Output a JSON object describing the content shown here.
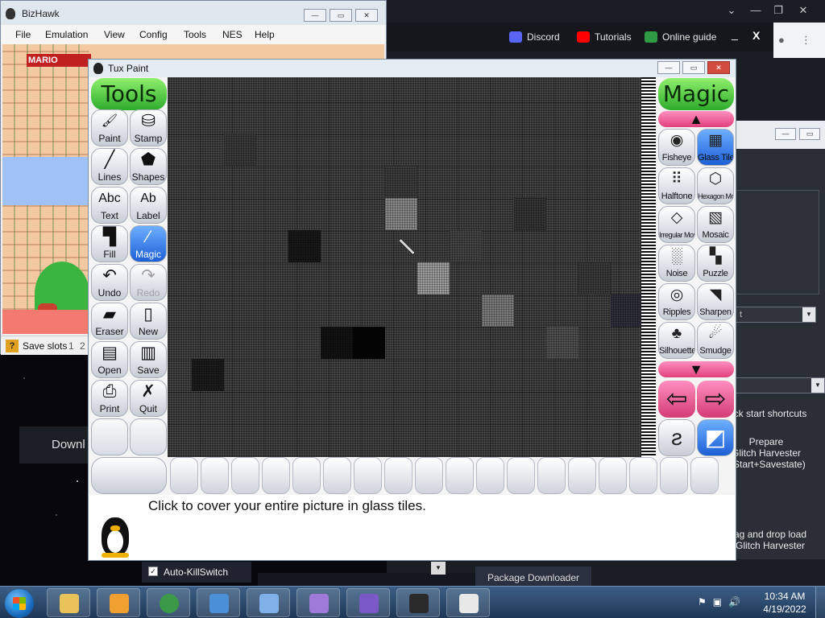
{
  "desktop": {
    "bg_color": "#07070c"
  },
  "launcher": {
    "buttons": {
      "discord": "Discord",
      "tutorials": "Tutorials",
      "online_guide": "Online guide"
    },
    "minimize": "_",
    "close": "X",
    "side_texts": {
      "quick_start": "ick start shortcuts",
      "prepare_1": "Prepare",
      "prepare_2": "Glitch Harvester",
      "prepare_3": "(Start+Savestate)",
      "drag_1": "ag and drop load",
      "drag_2": "Glitch Harvester"
    },
    "dropdown_fragment": "t",
    "download_fragment": "Downl",
    "package_downloader": "Package Downloader"
  },
  "bizhawk": {
    "title": "BizHawk",
    "menu": [
      "File",
      "Emulation",
      "View",
      "Config",
      "Tools",
      "NES",
      "Help"
    ],
    "game_logo": "MARIO",
    "status": {
      "label": "Save slots",
      "slot1": "1",
      "slot2": "2"
    }
  },
  "autokill": {
    "label": "Auto-KillSwitch",
    "checked": "✓"
  },
  "tuxpaint": {
    "title": "Tux Paint",
    "tools_header": "Tools",
    "magic_header": "Magic",
    "tools": [
      {
        "label": "Paint",
        "icon": "paintbrush-icon",
        "glyph": "🖌"
      },
      {
        "label": "Stamp",
        "icon": "stamp-icon",
        "glyph": "⛁"
      },
      {
        "label": "Lines",
        "icon": "lines-icon",
        "glyph": "╱"
      },
      {
        "label": "Shapes",
        "icon": "pentagon-icon",
        "glyph": "⬟"
      },
      {
        "label": "Text",
        "icon": "text-icon",
        "glyph": "Abc"
      },
      {
        "label": "Label",
        "icon": "label-icon",
        "glyph": "Ab"
      },
      {
        "label": "Fill",
        "icon": "bucket-icon",
        "glyph": "▜"
      },
      {
        "label": "Magic",
        "icon": "magic-wand-icon",
        "glyph": "⁄"
      },
      {
        "label": "Undo",
        "icon": "undo-icon",
        "glyph": "↶"
      },
      {
        "label": "Redo",
        "icon": "redo-icon",
        "glyph": "↷"
      },
      {
        "label": "Eraser",
        "icon": "eraser-icon",
        "glyph": "▰"
      },
      {
        "label": "New",
        "icon": "new-page-icon",
        "glyph": "▯"
      },
      {
        "label": "Open",
        "icon": "open-book-icon",
        "glyph": "▤"
      },
      {
        "label": "Save",
        "icon": "save-book-icon",
        "glyph": "▥"
      },
      {
        "label": "Print",
        "icon": "printer-icon",
        "glyph": "⎙"
      },
      {
        "label": "Quit",
        "icon": "quit-icon",
        "glyph": "✗"
      }
    ],
    "magic_tools": [
      {
        "label": "Fisheye",
        "icon": "fisheye-icon",
        "glyph": "◉"
      },
      {
        "label": "Glass Tile",
        "icon": "glass-tile-icon",
        "glyph": "▦"
      },
      {
        "label": "Halftone",
        "icon": "halftone-icon",
        "glyph": "⠿"
      },
      {
        "label": "Hexagon Mosaic",
        "icon": "hexagon-mosaic-icon",
        "glyph": "⬡"
      },
      {
        "label": "Irregular Mosaic",
        "icon": "irregular-mosaic-icon",
        "glyph": "◇"
      },
      {
        "label": "Mosaic",
        "icon": "mosaic-icon",
        "glyph": "▧"
      },
      {
        "label": "Noise",
        "icon": "noise-icon",
        "glyph": "░"
      },
      {
        "label": "Puzzle",
        "icon": "puzzle-icon",
        "glyph": "▚"
      },
      {
        "label": "Ripples",
        "icon": "ripples-icon",
        "glyph": "◎"
      },
      {
        "label": "Sharpen",
        "icon": "sharpen-icon",
        "glyph": "◥"
      },
      {
        "label": "Silhouette",
        "icon": "silhouette-icon",
        "glyph": "♣"
      },
      {
        "label": "Smudge",
        "icon": "smudge-icon",
        "glyph": "☄"
      }
    ],
    "arrow_up": "▲",
    "arrow_down": "▼",
    "nav_left": "⇦",
    "nav_right": "⇨",
    "mode_paint_glyph": "ƨ",
    "mode_fullscreen_glyph": "◩",
    "message": "Click to cover your entire picture in glass tiles."
  },
  "taskbar": {
    "clock_time": "10:34 AM",
    "clock_date": "4/19/2022",
    "tray_icons": [
      "flag-icon",
      "network-icon",
      "speaker-icon"
    ],
    "apps": [
      {
        "icon": "explorer-icon",
        "color": "#e8c35a"
      },
      {
        "icon": "media-player-icon",
        "color": "#f0a030"
      },
      {
        "icon": "chrome-icon",
        "color": "#3a9a4a"
      },
      {
        "icon": "monitor-app-icon",
        "color": "#4a8fd8"
      },
      {
        "icon": "control-panel-icon",
        "color": "#7fb0e8"
      },
      {
        "icon": "vanguard-icon",
        "color": "#9f7ad8"
      },
      {
        "icon": "glitch-cat-icon",
        "color": "#7a58c8"
      },
      {
        "icon": "anonymous-icon",
        "color": "#2a2a2a"
      },
      {
        "icon": "tux-icon",
        "color": "#e8e8e8"
      }
    ]
  }
}
